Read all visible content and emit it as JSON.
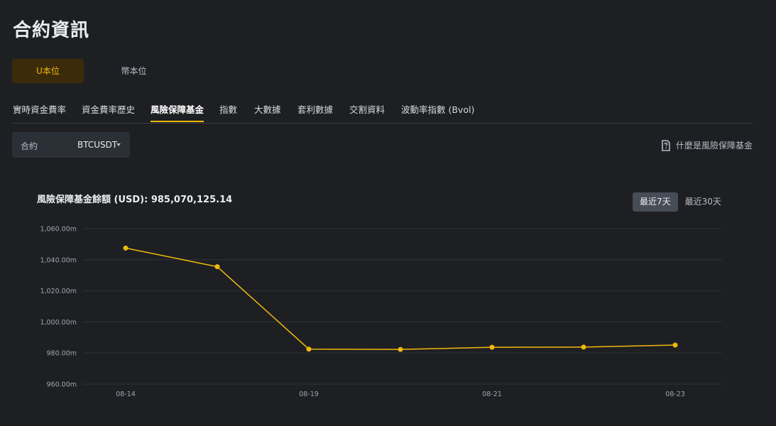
{
  "page": {
    "title": "合約資訊"
  },
  "unit_tabs": [
    {
      "label": "U本位",
      "active": true
    },
    {
      "label": "幣本位",
      "active": false
    }
  ],
  "sub_tabs": [
    {
      "label": "實時資金費率",
      "active": false
    },
    {
      "label": "資金費率歷史",
      "active": false
    },
    {
      "label": "風險保障基金",
      "active": true
    },
    {
      "label": "指數",
      "active": false
    },
    {
      "label": "大數據",
      "active": false
    },
    {
      "label": "套利數據",
      "active": false
    },
    {
      "label": "交割資料",
      "active": false
    },
    {
      "label": "波動率指數 (Bvol)",
      "active": false
    }
  ],
  "contract": {
    "label": "合約",
    "value": "BTCUSDT",
    "icon": "caret-down-icon"
  },
  "help": {
    "label": "什麼是風險保障基金",
    "icon": "help-document-icon"
  },
  "balance": {
    "text": "風險保障基金餘額 (USD): 985,070,125.14"
  },
  "range_buttons": [
    {
      "label": "最近7天",
      "active": true
    },
    {
      "label": "最近30天",
      "active": false
    }
  ],
  "colors": {
    "accent": "#f0b90b",
    "background": "#1e1f23",
    "grid": "#2e3238"
  },
  "chart_data": {
    "type": "line",
    "title": "",
    "xlabel": "",
    "ylabel": "",
    "ylim": [
      960,
      1060
    ],
    "yticks": [
      960,
      980,
      1000,
      1020,
      1040,
      1060
    ],
    "ytick_labels": [
      "960.00m",
      "980.00m",
      "1,000.00m",
      "1,020.00m",
      "1,040.00m",
      "1,060.00m"
    ],
    "x_labels": [
      "08-14",
      "08-19",
      "08-21",
      "08-23"
    ],
    "x_label_at": [
      0,
      2,
      4,
      6
    ],
    "series": [
      {
        "values": [
          1047.5,
          1035.5,
          982.5,
          982.3,
          983.7,
          983.8,
          985.1
        ]
      }
    ],
    "grid": true
  }
}
